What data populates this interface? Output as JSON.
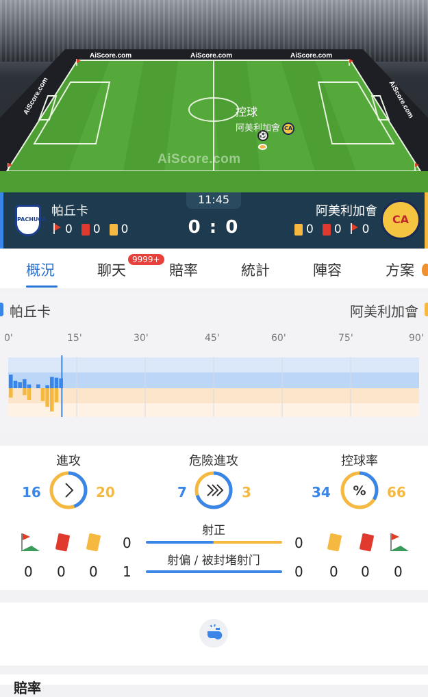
{
  "pitch": {
    "brand_label": "AiScore.com",
    "watermark": "AiScore.com",
    "possession_title": "控球",
    "possession_team": "阿美利加會"
  },
  "match": {
    "clock": "11:45",
    "score": "0 : 0",
    "home": {
      "name": "帕丘卡",
      "logo_text": "PACHUCA",
      "corners": "0",
      "red_cards": "0",
      "yellow_cards": "0"
    },
    "away": {
      "name": "阿美利加會",
      "logo_text": "CA",
      "corners": "0",
      "red_cards": "0",
      "yellow_cards": "0"
    }
  },
  "tabs": [
    {
      "label": "概況",
      "active": true
    },
    {
      "label": "聊天",
      "badge": "9999+"
    },
    {
      "label": "賠率"
    },
    {
      "label": "統計"
    },
    {
      "label": "陣容"
    },
    {
      "label": "方案"
    }
  ],
  "timeline": {
    "home_label": "帕丘卡",
    "away_label": "阿美利加會",
    "minutes": [
      "0'",
      "15'",
      "30'",
      "45'",
      "60'",
      "75'",
      "90'"
    ],
    "current_minute": 11.75,
    "home_pressure": [
      0.9,
      0.5,
      0.4,
      0.6,
      0.25,
      0.0,
      0.25,
      0.0,
      0.2,
      0.75,
      0.7,
      0.65
    ],
    "away_pressure": [
      0.4,
      0.0,
      0.0,
      0.3,
      0.5,
      0.0,
      0.0,
      0.55,
      0.8,
      1.0,
      0.6,
      0.0
    ],
    "colors": {
      "home": "#3a86e8",
      "away": "#f5b942"
    }
  },
  "stats": {
    "attack": {
      "label": "進攻",
      "home": "16",
      "away": "20",
      "home_value": 16,
      "away_value": 20,
      "icon": "chevron-right-icon"
    },
    "dangerous_attack": {
      "label": "危險進攻",
      "home": "7",
      "away": "3",
      "home_value": 7,
      "away_value": 3,
      "icon": "triple-chevron-icon"
    },
    "possession": {
      "label": "控球率",
      "home": "34",
      "away": "66",
      "home_value": 34,
      "away_value": 66,
      "icon": "percent-icon"
    },
    "on_target": {
      "label": "射正",
      "home": "0",
      "away": "0"
    },
    "off_target": {
      "label": "射偏 / 被封堵射门",
      "home": "1",
      "away": "0"
    },
    "home_counts": {
      "corners": "0",
      "red": "0",
      "yellow": "0"
    },
    "away_counts": {
      "yellow": "0",
      "red": "0",
      "corners": "0"
    }
  },
  "odds": {
    "title": "賠率"
  }
}
